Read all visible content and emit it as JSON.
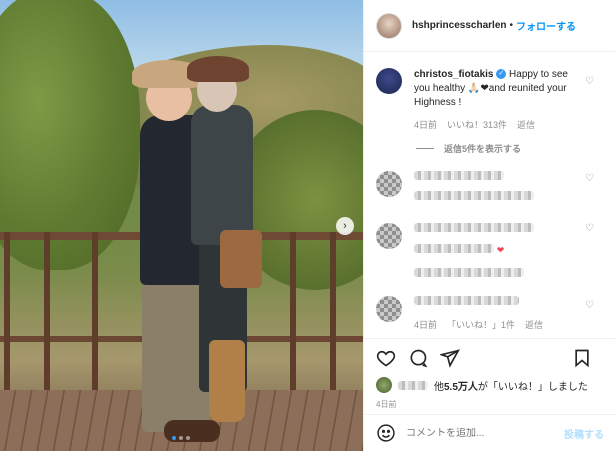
{
  "post": {
    "author": "hshprincesscharlen",
    "separator": "•",
    "follow_label": "フォローする"
  },
  "comments": [
    {
      "user": "christos_fiotakis",
      "verified": true,
      "text": "Happy to see you healthy 🙏🏻❤and reunited your Highness !",
      "time": "4日前",
      "likes": "いいね！313件",
      "reply": "返信",
      "view_replies": "返信5件を表示する"
    },
    {
      "user": "",
      "text": "",
      "blurred": true
    },
    {
      "user": "",
      "text": "",
      "blurred": true,
      "emoji": "❤"
    },
    {
      "user": "",
      "blurred": true,
      "time": "4日前",
      "likes": "「いいね！」1件",
      "reply": "返信"
    }
  ],
  "likes_summary": {
    "prefix": "他",
    "count": "5.5万人",
    "suffix": "が「いいね！」しました"
  },
  "post_date": "4日前",
  "add_comment": {
    "placeholder": "コメントを追加...",
    "post_label": "投稿する"
  },
  "icons": [
    "heart-icon",
    "comment-icon",
    "share-icon",
    "bookmark-icon",
    "emoji-icon",
    "next-arrow-icon"
  ],
  "colors": {
    "accent": "#0095f6",
    "post_disabled": "#b2dffc",
    "muted": "#8e8e8e"
  }
}
